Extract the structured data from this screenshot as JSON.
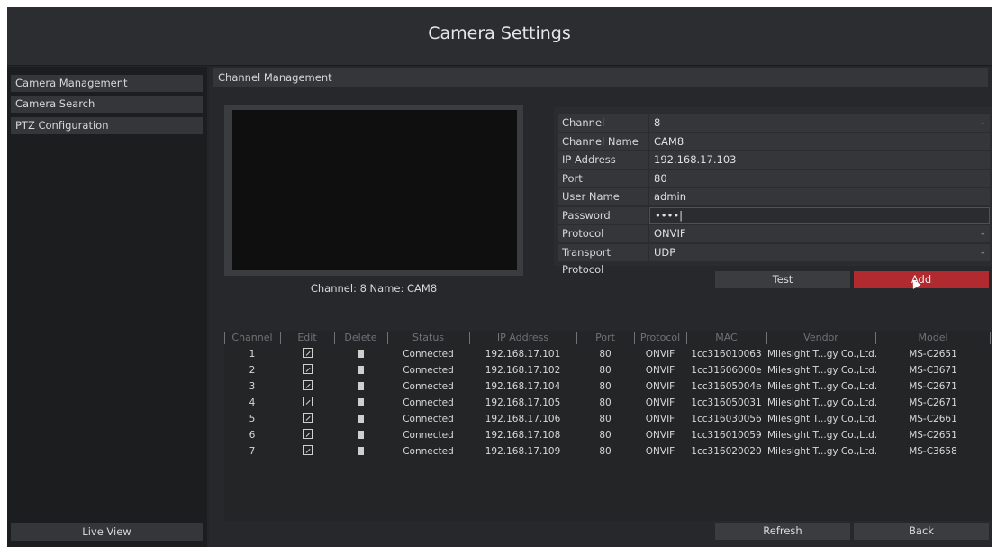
{
  "title": "Camera Settings",
  "sidebar": {
    "items": [
      {
        "label": "Camera Management"
      },
      {
        "label": "Camera Search"
      },
      {
        "label": "PTZ Configuration"
      }
    ],
    "live_view": "Live View"
  },
  "main": {
    "section_title": "Channel Management",
    "preview_caption": "Channel: 8 Name: CAM8",
    "form": {
      "channel": {
        "label": "Channel",
        "value": "8"
      },
      "channel_name": {
        "label": "Channel Name",
        "value": "CAM8"
      },
      "ip_address": {
        "label": "IP Address",
        "value": "192.168.17.103"
      },
      "port": {
        "label": "Port",
        "value": "80"
      },
      "user_name": {
        "label": "User Name",
        "value": "admin"
      },
      "password": {
        "label": "Password",
        "value": "••••|"
      },
      "protocol": {
        "label": "Protocol",
        "value": "ONVIF"
      },
      "transport": {
        "label": "Transport Protocol",
        "value": "UDP"
      }
    },
    "buttons": {
      "test": "Test",
      "add": "Add",
      "refresh": "Refresh",
      "back": "Back"
    },
    "table": {
      "headers": [
        "Channel",
        "Edit",
        "Delete",
        "Status",
        "IP Address",
        "Port",
        "Protocol",
        "MAC",
        "Vendor",
        "Model"
      ],
      "rows": [
        {
          "channel": "1",
          "status": "Connected",
          "ip": "192.168.17.101",
          "port": "80",
          "protocol": "ONVIF",
          "mac": "1cc316010063",
          "vendor": "Milesight T...gy Co.,Ltd.",
          "model": "MS-C2651"
        },
        {
          "channel": "2",
          "status": "Connected",
          "ip": "192.168.17.102",
          "port": "80",
          "protocol": "ONVIF",
          "mac": "1cc31606000e",
          "vendor": "Milesight T...gy Co.,Ltd.",
          "model": "MS-C3671"
        },
        {
          "channel": "3",
          "status": "Connected",
          "ip": "192.168.17.104",
          "port": "80",
          "protocol": "ONVIF",
          "mac": "1cc31605004e",
          "vendor": "Milesight T...gy Co.,Ltd.",
          "model": "MS-C2671"
        },
        {
          "channel": "4",
          "status": "Connected",
          "ip": "192.168.17.105",
          "port": "80",
          "protocol": "ONVIF",
          "mac": "1cc316050031",
          "vendor": "Milesight T...gy Co.,Ltd.",
          "model": "MS-C2671"
        },
        {
          "channel": "5",
          "status": "Connected",
          "ip": "192.168.17.106",
          "port": "80",
          "protocol": "ONVIF",
          "mac": "1cc316030056",
          "vendor": "Milesight T...gy Co.,Ltd.",
          "model": "MS-C2661"
        },
        {
          "channel": "6",
          "status": "Connected",
          "ip": "192.168.17.108",
          "port": "80",
          "protocol": "ONVIF",
          "mac": "1cc316010059",
          "vendor": "Milesight T...gy Co.,Ltd.",
          "model": "MS-C2651"
        },
        {
          "channel": "7",
          "status": "Connected",
          "ip": "192.168.17.109",
          "port": "80",
          "protocol": "ONVIF",
          "mac": "1cc316020020",
          "vendor": "Milesight T...gy Co.,Ltd.",
          "model": "MS-C3658"
        }
      ]
    }
  },
  "icons": {
    "edit": "edit-icon",
    "delete": "trash-icon",
    "dropdown": "chevron-down-icon"
  },
  "colors": {
    "accent": "#b02a2f",
    "background": "#232527",
    "panel": "#34363a"
  }
}
